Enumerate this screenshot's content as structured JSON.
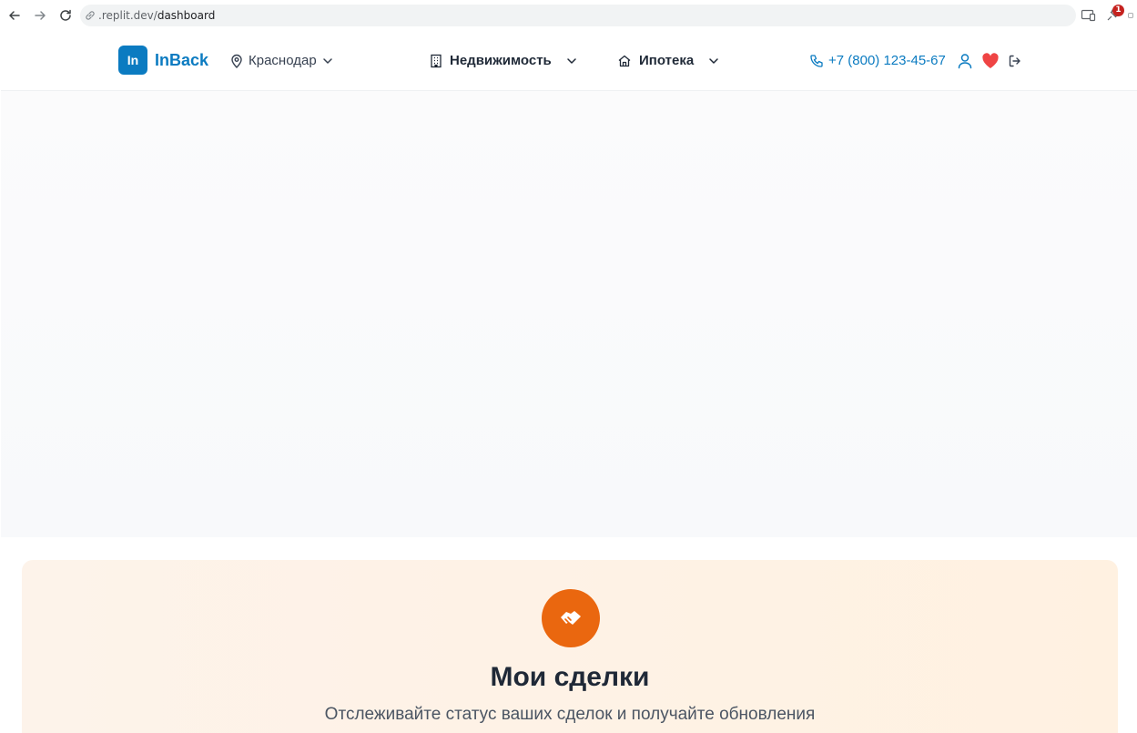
{
  "browser": {
    "url_host": ".replit.dev/",
    "url_path": "dashboard",
    "extension_badge": "1"
  },
  "header": {
    "logo_mark": "In",
    "logo_text": "InBack",
    "city": "Краснодар",
    "menu": [
      {
        "label": "Недвижимость",
        "icon": "building-icon"
      },
      {
        "label": "Ипотека",
        "icon": "home-icon"
      }
    ],
    "phone": "+7 (800) 123-45-67"
  },
  "deals": {
    "title": "Мои сделки",
    "subtitle": "Отслеживайте статус ваших сделок и получайте обновления"
  },
  "colors": {
    "brand": "#0b7bc1",
    "accent_orange": "#ea670f",
    "favorite_red": "#ef4444"
  }
}
